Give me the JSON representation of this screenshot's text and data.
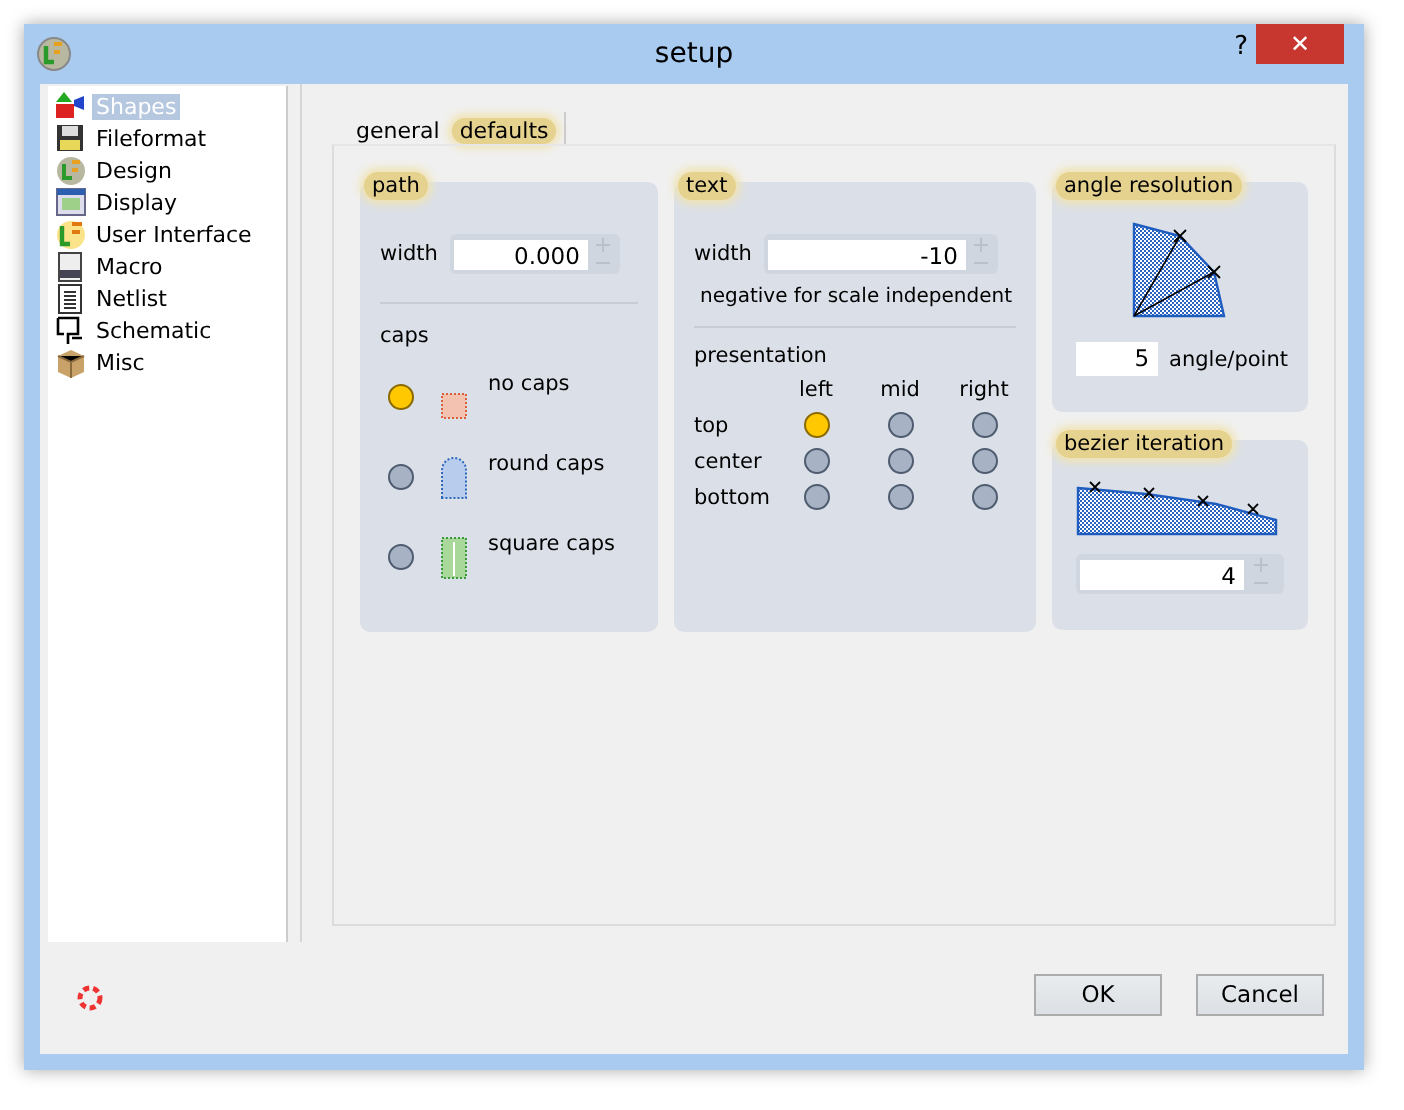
{
  "window": {
    "title": "setup",
    "help_button": "?",
    "close_button": "✕"
  },
  "sidebar": {
    "items": [
      {
        "label": "Shapes",
        "selected": true
      },
      {
        "label": "Fileformat",
        "selected": false
      },
      {
        "label": "Design",
        "selected": false
      },
      {
        "label": "Display",
        "selected": false
      },
      {
        "label": "User Interface",
        "selected": false
      },
      {
        "label": "Macro",
        "selected": false
      },
      {
        "label": "Netlist",
        "selected": false
      },
      {
        "label": "Schematic",
        "selected": false
      },
      {
        "label": "Misc",
        "selected": false
      }
    ]
  },
  "tabs": [
    {
      "label": "general",
      "selected": false
    },
    {
      "label": "defaults",
      "selected": true
    }
  ],
  "path": {
    "title": "path",
    "width_label": "width",
    "width_value": "0.000",
    "caps_label": "caps",
    "caps": [
      {
        "label": "no caps",
        "selected": true
      },
      {
        "label": "round caps",
        "selected": false
      },
      {
        "label": "square caps",
        "selected": false
      }
    ]
  },
  "text": {
    "title": "text",
    "width_label": "width",
    "width_value": "-10",
    "note": "negative for scale independent",
    "presentation_label": "presentation",
    "columns": [
      "left",
      "mid",
      "right"
    ],
    "rows": [
      {
        "label": "top",
        "cells": [
          {
            "selected": true
          },
          {
            "selected": false
          },
          {
            "selected": false
          }
        ]
      },
      {
        "label": "center",
        "cells": [
          {
            "selected": false
          },
          {
            "selected": false
          },
          {
            "selected": false
          }
        ]
      },
      {
        "label": "bottom",
        "cells": [
          {
            "selected": false
          },
          {
            "selected": false
          },
          {
            "selected": false
          }
        ]
      }
    ]
  },
  "angle_resolution": {
    "title": "angle resolution",
    "value": "5",
    "unit": "angle/point"
  },
  "bezier_iteration": {
    "title": "bezier iteration",
    "value": "4"
  },
  "buttons": [
    "OK",
    "Cancel"
  ]
}
